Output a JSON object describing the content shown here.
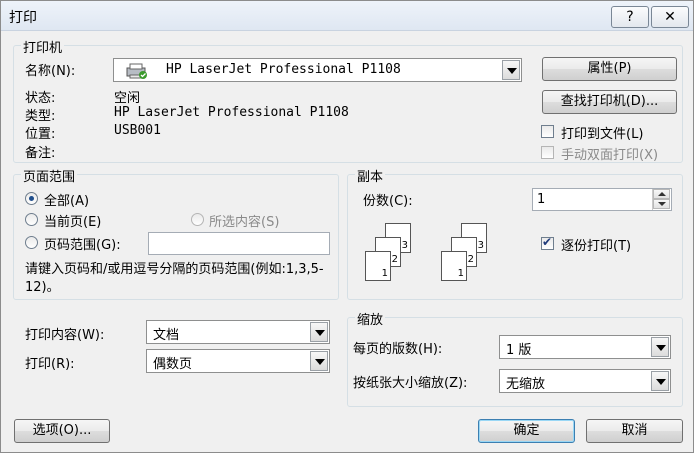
{
  "window": {
    "title": "打印",
    "help_label": "?",
    "close_label": "✕"
  },
  "printer": {
    "legend": "打印机",
    "name_label": "名称(N):",
    "name_value": "HP LaserJet Professional P1108",
    "properties_button": "属性(P)",
    "status_label": "状态:",
    "status_value": "空闲",
    "type_label": "类型:",
    "type_value": "HP LaserJet Professional P1108",
    "where_label": "位置:",
    "where_value": "USB001",
    "comment_label": "备注:",
    "find_printer_button": "查找打印机(D)...",
    "print_to_file_label": "打印到文件(L)",
    "print_to_file_checked": false,
    "manual_duplex_label": "手动双面打印(X)",
    "manual_duplex_checked": false
  },
  "page_range": {
    "legend": "页面范围",
    "all_label": "全部(A)",
    "current_label": "当前页(E)",
    "selection_label": "所选内容(S)",
    "pages_label": "页码范围(G):",
    "pages_value": "",
    "selected": "all",
    "hint": "请键入页码和/或用逗号分隔的页码范围(例如:1,3,5-12)。"
  },
  "copies": {
    "legend": "副本",
    "count_label": "份数(C):",
    "count_value": "1",
    "collate_label": "逐份打印(T)",
    "collate_checked": true,
    "page_numbers": [
      "1",
      "2",
      "3"
    ]
  },
  "print_what": {
    "label": "打印内容(W):",
    "value": "文档"
  },
  "print": {
    "label": "打印(R):",
    "value": "偶数页"
  },
  "zoom": {
    "legend": "缩放",
    "pages_per_sheet_label": "每页的版数(H):",
    "pages_per_sheet_value": "1 版",
    "scale_label": "按纸张大小缩放(Z):",
    "scale_value": "无缩放"
  },
  "footer": {
    "options_button": "选项(O)...",
    "ok_button": "确定",
    "cancel_button": "取消"
  }
}
